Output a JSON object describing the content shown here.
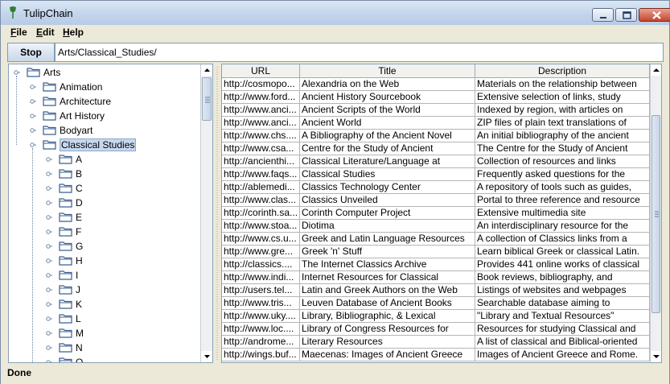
{
  "window": {
    "title": "TulipChain"
  },
  "menu": [
    {
      "mnemonic": "F",
      "rest": "ile"
    },
    {
      "mnemonic": "E",
      "rest": "dit"
    },
    {
      "mnemonic": "H",
      "rest": "elp"
    }
  ],
  "toolbar": {
    "stop_label": "Stop",
    "path": "Arts/Classical_Studies/"
  },
  "tree": {
    "root": "Arts",
    "level1": [
      "Animation",
      "Architecture",
      "Art History",
      "Bodyart",
      "Classical Studies"
    ],
    "selected": "Classical Studies",
    "level2": [
      "A",
      "B",
      "C",
      "D",
      "E",
      "F",
      "G",
      "H",
      "I",
      "J",
      "K",
      "L",
      "M",
      "N",
      "O"
    ]
  },
  "table": {
    "columns": [
      "URL",
      "Title",
      "Description"
    ],
    "rows": [
      [
        "http://cosmopo...",
        "Alexandria on the Web",
        "Materials on the relationship between"
      ],
      [
        "http://www.ford...",
        "Ancient History Sourcebook",
        "Extensive selection of links, study"
      ],
      [
        "http://www.anci...",
        "Ancient Scripts of the World",
        "Indexed by region, with articles on"
      ],
      [
        "http://www.anci...",
        "Ancient World",
        "ZIP files of plain text translations of"
      ],
      [
        "http://www.chs....",
        "A Bibliography of the Ancient Novel",
        "An initial bibliography of the ancient"
      ],
      [
        "http://www.csa...",
        "Centre for the Study of Ancient",
        "The Centre for the Study of Ancient"
      ],
      [
        "http://ancienthi...",
        "Classical Literature/Language at",
        "Collection of resources and links"
      ],
      [
        "http://www.faqs...",
        "Classical Studies",
        "Frequently asked questions for the"
      ],
      [
        "http://ablemedi...",
        "Classics Technology Center",
        "A repository of tools such as guides,"
      ],
      [
        "http://www.clas...",
        "Classics Unveiled",
        "Portal to three reference and resource"
      ],
      [
        "http://corinth.sa...",
        "Corinth Computer Project",
        "Extensive multimedia site"
      ],
      [
        "http://www.stoa...",
        "Diotima",
        "An interdisciplinary resource for the"
      ],
      [
        "http://www.cs.u...",
        "Greek and Latin Language Resources",
        "A collection of Classics links from a"
      ],
      [
        "http://www.gre...",
        "Greek 'n' Stuff",
        "Learn biblical Greek or classical Latin."
      ],
      [
        "http://classics....",
        "The Internet Classics Archive",
        "Provides 441 online works of classical"
      ],
      [
        "http://www.indi...",
        "Internet Resources for Classical",
        "Book reviews, bibliography, and"
      ],
      [
        "http://users.tel...",
        "Latin and Greek Authors on the Web",
        "Listings of websites and webpages"
      ],
      [
        "http://www.tris...",
        "Leuven Database of Ancient Books",
        "Searchable database aiming to"
      ],
      [
        "http://www.uky....",
        "Library, Bibliographic, & Lexical",
        "\"Library and Textual Resources\""
      ],
      [
        "http://www.loc....",
        "Library of Congress Resources for",
        "Resources for studying Classical and"
      ],
      [
        "http://androme...",
        "Literary Resources",
        "A list of classical and Biblical-oriented"
      ],
      [
        "http://wings.buf...",
        "Maecenas: Images of Ancient Greece",
        "Images of Ancient Greece and Rome."
      ]
    ]
  },
  "status": {
    "text": "Done"
  },
  "colors": {
    "selection": "#c7d8ee",
    "tree_line": "#6a86a8",
    "folder": "#3b5f8f"
  },
  "icons": {
    "tree_handle": "tree-handle-icon",
    "folder": "folder-icon",
    "app": "tulip-icon"
  }
}
